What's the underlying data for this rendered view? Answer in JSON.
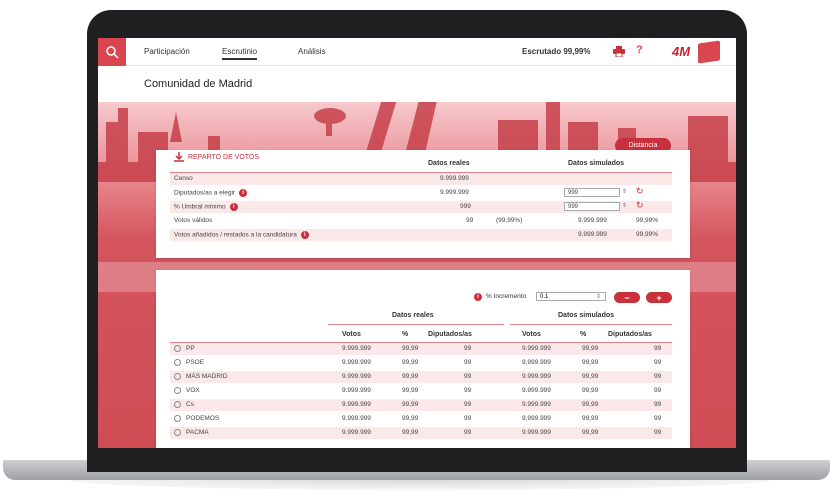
{
  "nav": {
    "items": [
      "Participación",
      "Escrutinio",
      "Análisis"
    ],
    "escrutado": "Escrutado 99,99%",
    "help": "?",
    "logo": "4M"
  },
  "page_title": "Comunidad de Madrid",
  "buttons": {
    "distancia": "Distancia",
    "minus": "−",
    "plus": "+"
  },
  "reparto": {
    "title": "REPARTO DE VOTOS",
    "col_real": "Datos reales",
    "col_sim": "Datos simulados",
    "rows": {
      "censo": {
        "label": "Censo",
        "real": "9.999.999"
      },
      "diputados": {
        "label": "Diputados/as a elegir",
        "real": "9.999.999",
        "input": "999"
      },
      "umbral": {
        "label": "% Umbral mínimo",
        "real": "999",
        "input": "999"
      },
      "validos": {
        "label": "Votos válidos",
        "real": "99",
        "pct": "(99,99%)",
        "sim": "9.999.999",
        "sim_pct": "99,99%"
      },
      "anadidos": {
        "label": "Votos añadidos / restados  a la candidatura",
        "sim": "9.999.999",
        "sim_pct": "99,99%"
      }
    }
  },
  "incremento": {
    "label": "% Incremento",
    "value": "0.1"
  },
  "table": {
    "group_real": "Datos reales",
    "group_sim": "Datos simulados",
    "headers": [
      "Votos",
      "%",
      "Diputados/as",
      "Votos",
      "%",
      "Diputados/as"
    ],
    "rows": [
      {
        "party": "PP",
        "votos": "9.999.999",
        "pct": "99,99",
        "dip": "99",
        "s_votos": "9.999.999",
        "s_pct": "99,99",
        "s_dip": "99"
      },
      {
        "party": "PSOE",
        "votos": "9.999.999",
        "pct": "99,99",
        "dip": "99",
        "s_votos": "9.999.999",
        "s_pct": "99,99",
        "s_dip": "99"
      },
      {
        "party": "MÁS MADRID",
        "votos": "9.999.999",
        "pct": "99,99",
        "dip": "99",
        "s_votos": "9.999.999",
        "s_pct": "99,99",
        "s_dip": "99"
      },
      {
        "party": "VOX",
        "votos": "9.999.999",
        "pct": "99,99",
        "dip": "99",
        "s_votos": "9.999.999",
        "s_pct": "99,99",
        "s_dip": "99"
      },
      {
        "party": "Cs",
        "votos": "9.999.999",
        "pct": "99,99",
        "dip": "99",
        "s_votos": "9.999.999",
        "s_pct": "99,99",
        "s_dip": "99"
      },
      {
        "party": "PODEMOS",
        "votos": "9.999.999",
        "pct": "99,99",
        "dip": "99",
        "s_votos": "9.999.999",
        "s_pct": "99,99",
        "s_dip": "99"
      },
      {
        "party": "PACMA",
        "votos": "9.999.999",
        "pct": "99,99",
        "dip": "99",
        "s_votos": "9.999.999",
        "s_pct": "99,99",
        "s_dip": "99"
      }
    ]
  },
  "colors": {
    "accent": "#c8303b",
    "banner": "#d4545d"
  }
}
